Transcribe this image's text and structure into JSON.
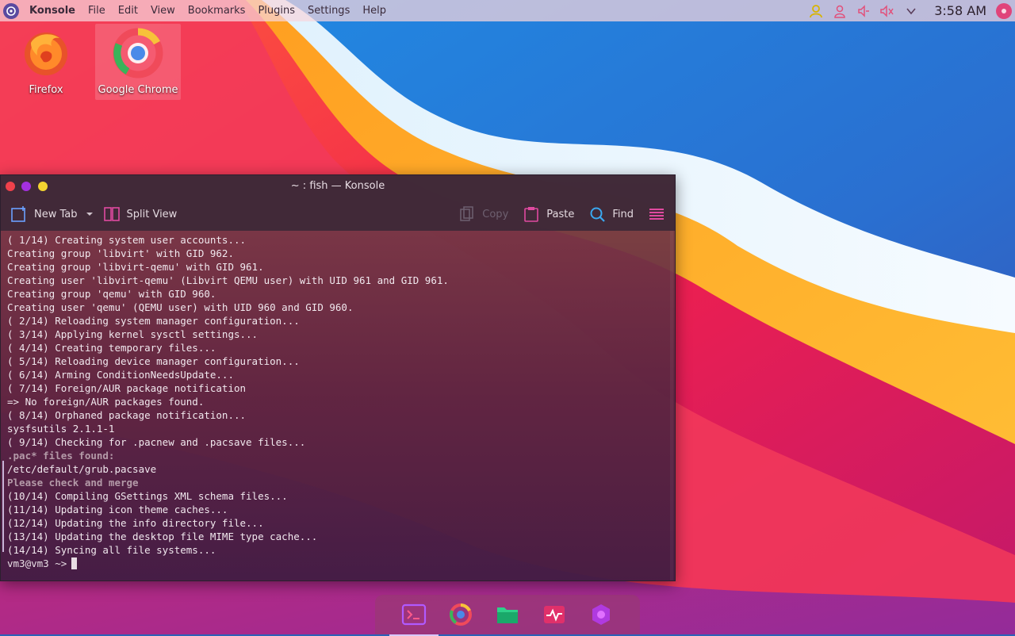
{
  "top_panel": {
    "app_name": "Konsole",
    "menus": [
      "File",
      "Edit",
      "View",
      "Bookmarks",
      "Plugins",
      "Settings",
      "Help"
    ],
    "clock": "3:58 AM",
    "tray_icons": [
      "user-icon",
      "person-icon",
      "volume-icon",
      "muted-speaker-icon",
      "chevron-down-icon"
    ]
  },
  "desktop": {
    "icons": [
      {
        "label": "Firefox",
        "icon": "firefox-icon"
      },
      {
        "label": "Google Chrome",
        "icon": "chrome-icon"
      }
    ]
  },
  "window": {
    "title": "~ : fish — Konsole",
    "toolbar": {
      "new_tab": "New Tab",
      "split_view": "Split View",
      "copy": "Copy",
      "paste": "Paste",
      "find": "Find"
    },
    "terminal": {
      "lines": [
        "( 1/14) Creating system user accounts...",
        "Creating group 'libvirt' with GID 962.",
        "Creating group 'libvirt-qemu' with GID 961.",
        "Creating user 'libvirt-qemu' (Libvirt QEMU user) with UID 961 and GID 961.",
        "Creating group 'qemu' with GID 960.",
        "Creating user 'qemu' (QEMU user) with UID 960 and GID 960.",
        "( 2/14) Reloading system manager configuration...",
        "( 3/14) Applying kernel sysctl settings...",
        "( 4/14) Creating temporary files...",
        "( 5/14) Reloading device manager configuration...",
        "( 6/14) Arming ConditionNeedsUpdate...",
        "( 7/14) Foreign/AUR package notification",
        "=> No foreign/AUR packages found.",
        "( 8/14) Orphaned package notification...",
        "sysfsutils 2.1.1-1",
        "( 9/14) Checking for .pacnew and .pacsave files...",
        ".pac* files found:",
        "/etc/default/grub.pacsave",
        "Please check and merge",
        "(10/14) Compiling GSettings XML schema files...",
        "(11/14) Updating icon theme caches...",
        "(12/14) Updating the info directory file...",
        "(13/14) Updating the desktop file MIME type cache...",
        "(14/14) Syncing all file systems..."
      ],
      "prompt": "vm3@vm3 ~>"
    }
  },
  "dock": {
    "items": [
      "terminal-icon",
      "chrome-icon",
      "files-icon",
      "system-monitor-icon",
      "settings-icon"
    ],
    "active": "terminal-icon"
  }
}
